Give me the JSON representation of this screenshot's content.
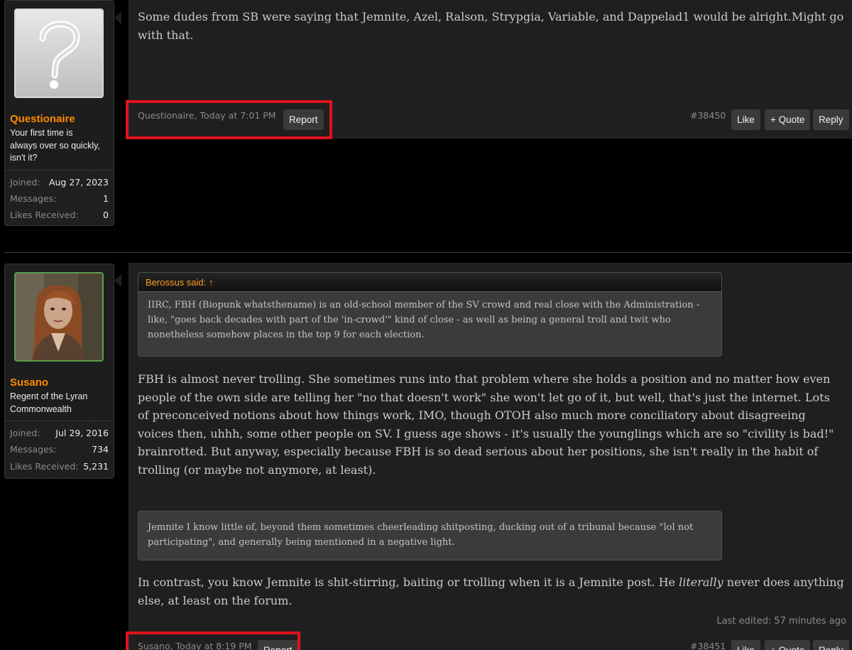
{
  "posts": [
    {
      "username": "Questionaire",
      "user_title": "Your first time is always over so quickly, isn't it?",
      "avatar_icon": "question-mark-avatar",
      "stats": [
        {
          "label": "Joined:",
          "value": "Aug 27, 2023"
        },
        {
          "label": "Messages:",
          "value": "1"
        },
        {
          "label": "Likes Received:",
          "value": "0"
        }
      ],
      "message": "Some dudes from SB were saying that Jemnite, Azel, Ralson, Strypgia, Variable, and Dappelad1 would be alright.Might go with that.",
      "meta": "Questionaire, Today at 7:01 PM",
      "report_label": "Report",
      "post_number": "#38450",
      "like_label": "Like",
      "quote_label": "+ Quote",
      "reply_label": "Reply"
    },
    {
      "username": "Susano",
      "user_title": "Regent of the Lyran Commonwealth",
      "avatar_icon": "portrait-avatar",
      "stats": [
        {
          "label": "Joined:",
          "value": "Jul 29, 2016"
        },
        {
          "label": "Messages:",
          "value": "734"
        },
        {
          "label": "Likes Received:",
          "value": "5,231"
        }
      ],
      "quote_author": "Berossus said: ↑",
      "quote_text": "IIRC, FBH (Biopunk whatsthename) is an old-school member of the SV crowd and real close with the Administration - like, \"goes back decades with part of the 'in-crowd'\" kind of close - as well as being a general troll and twit who nonetheless somehow places in the top 9 for each election.",
      "message_1": "FBH is almost never trolling. She sometimes runs into that problem where she holds a position and no matter how even people of the own side are telling her \"no that doesn't work\" she won't let go of it, but well, that's just the internet. Lots of preconceived notions about how things work, IMO, though OTOH also much more conciliatory about disagreeing voices then, uhhh, some other people on SV. I guess age shows - it's usually the younglings which are so \"civility is bad!\" brainrotted. But anyway, especially because FBH is so dead serious about her positions, she isn't really in the habit of trolling (or maybe not anymore, at least).",
      "quote_2_text": "Jemnite I know little of, beyond them sometimes cheerleading shitposting, ducking out of a tribunal because \"lol not participating\", and generally being mentioned in a negative light.",
      "message_2_before": "In contrast, you know Jemnite is shit-stirring, baiting or trolling when it is a Jemnite post. He ",
      "message_2_emphasis": "literally",
      "message_2_after": " never does anything else, at least on the forum.",
      "last_edited": "Last edited: 57 minutes ago",
      "meta": "Susano, Today at 8:19 PM",
      "report_label": "Report",
      "post_number": "#38451",
      "like_label": "Like",
      "quote_label": "+ Quote",
      "reply_label": "Reply"
    }
  ],
  "colors": {
    "username": "#ff8a00",
    "highlight": "#e0121c",
    "background": "#000000",
    "post_bg": "#1f1f1f"
  }
}
